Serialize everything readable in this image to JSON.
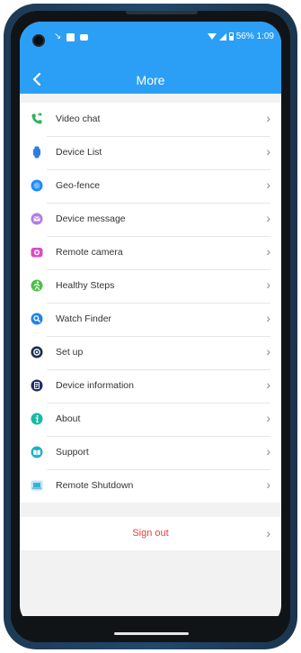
{
  "status_bar": {
    "battery_time": "56% 1:09"
  },
  "header": {
    "title": "More"
  },
  "menu": {
    "items": [
      {
        "label": "Video chat",
        "icon": "phone-icon",
        "color": "#2fb35a"
      },
      {
        "label": "Device List",
        "icon": "watch-icon",
        "color": "#2b7fe0"
      },
      {
        "label": "Geo-fence",
        "icon": "circle-icon",
        "color": "#1f8bff"
      },
      {
        "label": "Device message",
        "icon": "message-icon",
        "color": "#b57ae6"
      },
      {
        "label": "Remote camera",
        "icon": "camera-icon",
        "color": "#d94cc7"
      },
      {
        "label": "Healthy Steps",
        "icon": "walk-icon",
        "color": "#4cc04a"
      },
      {
        "label": "Watch Finder",
        "icon": "search-icon",
        "color": "#1c86e6"
      },
      {
        "label": "Set up",
        "icon": "gear-icon",
        "color": "#1a2f4a"
      },
      {
        "label": "Device information",
        "icon": "document-icon",
        "color": "#1e2e68"
      },
      {
        "label": "About",
        "icon": "info-icon",
        "color": "#1ab8a3"
      },
      {
        "label": "Support",
        "icon": "book-icon",
        "color": "#20b1c8"
      },
      {
        "label": "Remote Shutdown",
        "icon": "laptop-icon",
        "color": "#39b0d8"
      }
    ]
  },
  "signout": {
    "label": "Sign out"
  },
  "colors": {
    "accent": "#2b9ff6",
    "signout_text": "#ee3b3b"
  }
}
